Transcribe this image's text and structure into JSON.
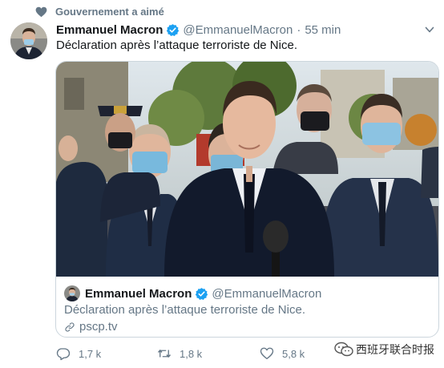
{
  "social_context": {
    "text": "Gouvernement a aimé",
    "icon": "heart-icon"
  },
  "tweet": {
    "author_name": "Emmanuel Macron",
    "handle": "@EmmanuelMacron",
    "separator": "·",
    "time": "55 min",
    "text": "Déclaration après l’attaque terroriste de Nice."
  },
  "quoted": {
    "author_name": "Emmanuel Macron",
    "handle": "@EmmanuelMacron",
    "text": "Déclaration après l’attaque terroriste de Nice.",
    "link": "pscp.tv"
  },
  "actions": {
    "replies": "1,7 k",
    "retweets": "1,8 k",
    "likes": "5,8 k"
  },
  "watermark": {
    "text": "西班牙联合时报"
  },
  "colors": {
    "verified": "#1da1f2",
    "muted": "#657786",
    "border": "#ccd6dd"
  }
}
